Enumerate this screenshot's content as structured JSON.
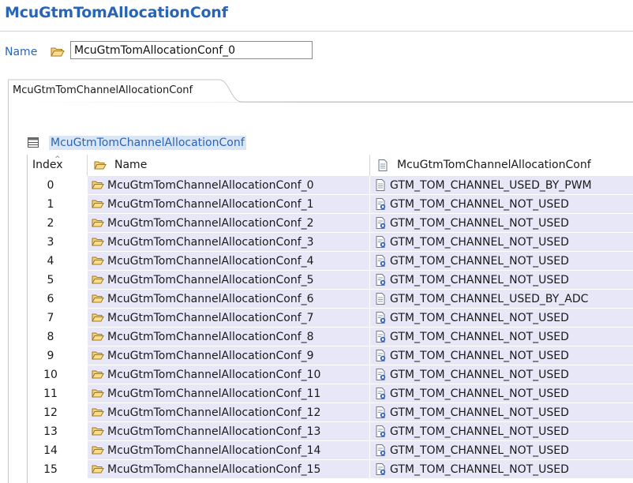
{
  "header": {
    "title": "McuGtmTomAllocationConf"
  },
  "name_field": {
    "label": "Name",
    "value": "McuGtmTomAllocationConf_0",
    "icon": "folder-open-icon"
  },
  "tab": {
    "label": "McuGtmTomChannelAllocationConf"
  },
  "section": {
    "label": "McuGtmTomChannelAllocationConf",
    "icon": "table-icon"
  },
  "table": {
    "columns": [
      "Index",
      "Name",
      "McuGtmTomChannelAllocationConf"
    ],
    "rows": [
      {
        "index": "0",
        "name": "McuGtmTomChannelAllocationConf_0",
        "value": "GTM_TOM_CHANNEL_USED_BY_PWM",
        "default": false
      },
      {
        "index": "1",
        "name": "McuGtmTomChannelAllocationConf_1",
        "value": "GTM_TOM_CHANNEL_NOT_USED",
        "default": true
      },
      {
        "index": "2",
        "name": "McuGtmTomChannelAllocationConf_2",
        "value": "GTM_TOM_CHANNEL_NOT_USED",
        "default": true
      },
      {
        "index": "3",
        "name": "McuGtmTomChannelAllocationConf_3",
        "value": "GTM_TOM_CHANNEL_NOT_USED",
        "default": true
      },
      {
        "index": "4",
        "name": "McuGtmTomChannelAllocationConf_4",
        "value": "GTM_TOM_CHANNEL_NOT_USED",
        "default": true
      },
      {
        "index": "5",
        "name": "McuGtmTomChannelAllocationConf_5",
        "value": "GTM_TOM_CHANNEL_NOT_USED",
        "default": true
      },
      {
        "index": "6",
        "name": "McuGtmTomChannelAllocationConf_6",
        "value": "GTM_TOM_CHANNEL_USED_BY_ADC",
        "default": false
      },
      {
        "index": "7",
        "name": "McuGtmTomChannelAllocationConf_7",
        "value": "GTM_TOM_CHANNEL_NOT_USED",
        "default": true
      },
      {
        "index": "8",
        "name": "McuGtmTomChannelAllocationConf_8",
        "value": "GTM_TOM_CHANNEL_NOT_USED",
        "default": true
      },
      {
        "index": "9",
        "name": "McuGtmTomChannelAllocationConf_9",
        "value": "GTM_TOM_CHANNEL_NOT_USED",
        "default": true
      },
      {
        "index": "10",
        "name": "McuGtmTomChannelAllocationConf_10",
        "value": "GTM_TOM_CHANNEL_NOT_USED",
        "default": true
      },
      {
        "index": "11",
        "name": "McuGtmTomChannelAllocationConf_11",
        "value": "GTM_TOM_CHANNEL_NOT_USED",
        "default": true
      },
      {
        "index": "12",
        "name": "McuGtmTomChannelAllocationConf_12",
        "value": "GTM_TOM_CHANNEL_NOT_USED",
        "default": true
      },
      {
        "index": "13",
        "name": "McuGtmTomChannelAllocationConf_13",
        "value": "GTM_TOM_CHANNEL_NOT_USED",
        "default": true
      },
      {
        "index": "14",
        "name": "McuGtmTomChannelAllocationConf_14",
        "value": "GTM_TOM_CHANNEL_NOT_USED",
        "default": true
      },
      {
        "index": "15",
        "name": "McuGtmTomChannelAllocationConf_15",
        "value": "GTM_TOM_CHANNEL_NOT_USED",
        "default": true
      }
    ]
  },
  "colors": {
    "accent": "#2965b5",
    "row_bg": "#e7e7f8",
    "folder": "#e8b84a"
  }
}
